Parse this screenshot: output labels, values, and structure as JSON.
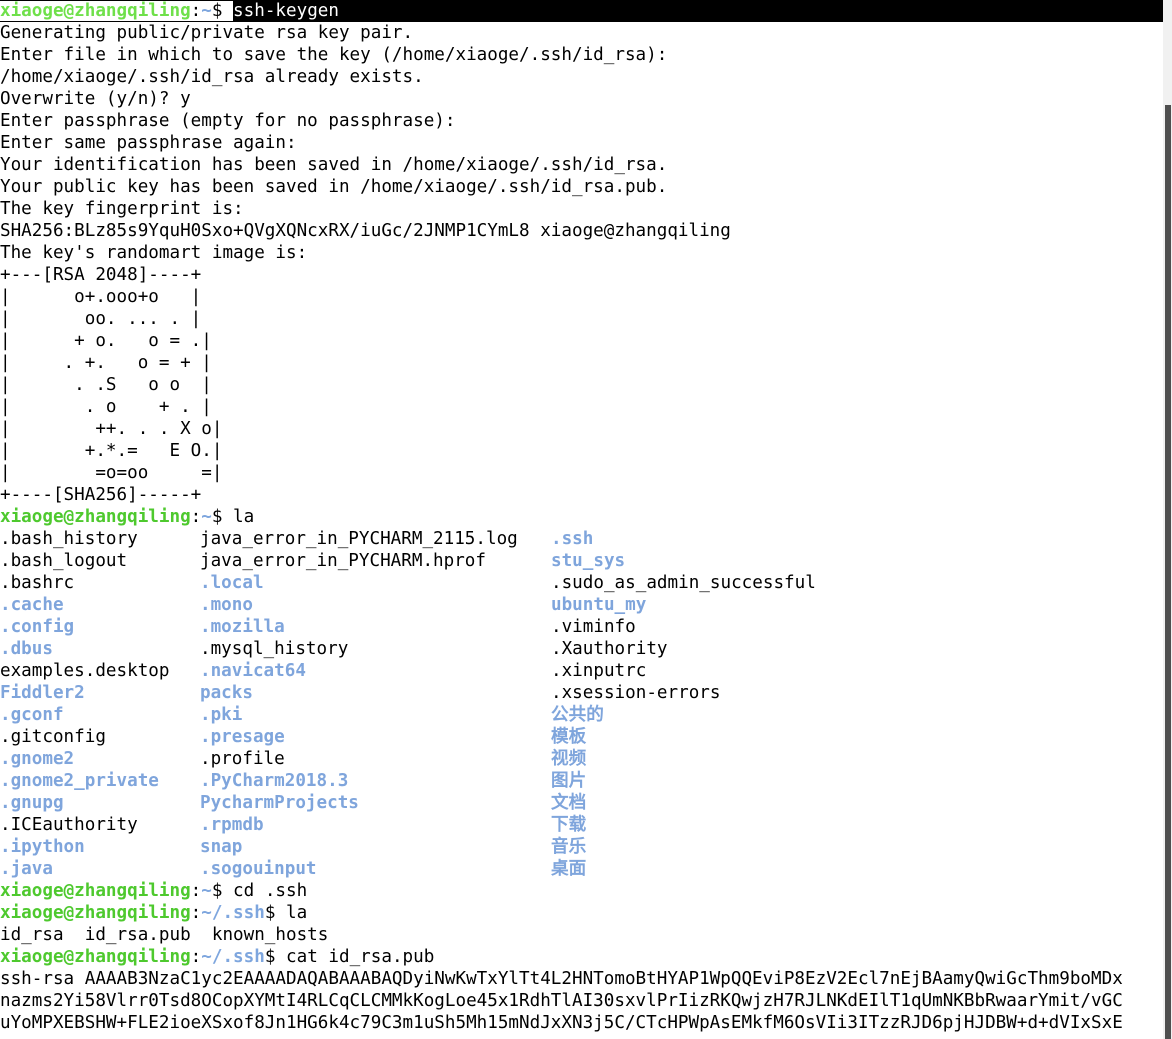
{
  "terminal": {
    "title": "xiaoge@zhangqiling: ~/.ssh",
    "colors": {
      "background": "#ffffff",
      "foreground": "#000000",
      "prompt_user_green": "#4ec92e",
      "path_blue": "#7ea6de",
      "directory_blue": "#7fa5dc",
      "highlight_background": "#000000",
      "highlight_foreground": "#ffffff",
      "scrollbar_thumb": "#4f4f4f",
      "scrollbar_track": "#f1f1f1"
    },
    "prompt": {
      "user_host": "xiaoge@zhangqiling",
      "colon": ":",
      "home_tilde": "~",
      "ssh_path": "/.ssh",
      "dollar": "$"
    },
    "commands": {
      "ssh_keygen": "ssh-keygen",
      "la": "la",
      "cd_ssh": "cd .ssh",
      "cat_id_rsa_pub": "cat id_rsa.pub"
    },
    "keygen_output": [
      "Generating public/private rsa key pair.",
      "Enter file in which to save the key (/home/xiaoge/.ssh/id_rsa):",
      "/home/xiaoge/.ssh/id_rsa already exists.",
      "Overwrite (y/n)? y",
      "Enter passphrase (empty for no passphrase):",
      "Enter same passphrase again:",
      "Your identification has been saved in /home/xiaoge/.ssh/id_rsa.",
      "Your public key has been saved in /home/xiaoge/.ssh/id_rsa.pub.",
      "The key fingerprint is:",
      "SHA256:BLz85s9YquH0Sxo+QVgXQNcxRX/iuGc/2JNMP1CYmL8 xiaoge@zhangqiling",
      "The key's randomart image is:"
    ],
    "randomart": [
      "+---[RSA 2048]----+",
      "|      o+.ooo+o   |",
      "|       oo. ... . |",
      "|      + o.   o = .|",
      "|     . +.   o = + |",
      "|      . .S   o o  |",
      "|       . o    + . |",
      "|        ++. . . X o|",
      "|       +.*.=   E O.|",
      "|        =o=oo     =|",
      "+----[SHA256]-----+"
    ],
    "listing_home": {
      "col1": [
        {
          "name": ".bash_history",
          "type": "file"
        },
        {
          "name": ".bash_logout",
          "type": "file"
        },
        {
          "name": ".bashrc",
          "type": "file"
        },
        {
          "name": ".cache",
          "type": "dir"
        },
        {
          "name": ".config",
          "type": "dir"
        },
        {
          "name": ".dbus",
          "type": "dir"
        },
        {
          "name": "examples.desktop",
          "type": "file"
        },
        {
          "name": "Fiddler2",
          "type": "dir"
        },
        {
          "name": ".gconf",
          "type": "dir"
        },
        {
          "name": ".gitconfig",
          "type": "file"
        },
        {
          "name": ".gnome2",
          "type": "dir"
        },
        {
          "name": ".gnome2_private",
          "type": "dir"
        },
        {
          "name": ".gnupg",
          "type": "dir"
        },
        {
          "name": ".ICEauthority",
          "type": "file"
        },
        {
          "name": ".ipython",
          "type": "dir"
        },
        {
          "name": ".java",
          "type": "dir"
        }
      ],
      "col2": [
        {
          "name": "java_error_in_PYCHARM_2115.log",
          "type": "file"
        },
        {
          "name": "java_error_in_PYCHARM.hprof",
          "type": "file"
        },
        {
          "name": ".local",
          "type": "dir"
        },
        {
          "name": ".mono",
          "type": "dir"
        },
        {
          "name": ".mozilla",
          "type": "dir"
        },
        {
          "name": ".mysql_history",
          "type": "file"
        },
        {
          "name": ".navicat64",
          "type": "dir"
        },
        {
          "name": "packs",
          "type": "dir"
        },
        {
          "name": ".pki",
          "type": "dir"
        },
        {
          "name": ".presage",
          "type": "dir"
        },
        {
          "name": ".profile",
          "type": "file"
        },
        {
          "name": ".PyCharm2018.3",
          "type": "dir"
        },
        {
          "name": "PycharmProjects",
          "type": "dir"
        },
        {
          "name": ".rpmdb",
          "type": "dir"
        },
        {
          "name": "snap",
          "type": "dir"
        },
        {
          "name": ".sogouinput",
          "type": "dir"
        }
      ],
      "col3": [
        {
          "name": ".ssh",
          "type": "dir"
        },
        {
          "name": "stu_sys",
          "type": "dir"
        },
        {
          "name": ".sudo_as_admin_successful",
          "type": "file"
        },
        {
          "name": "ubuntu_my",
          "type": "dir"
        },
        {
          "name": ".viminfo",
          "type": "file"
        },
        {
          "name": ".Xauthority",
          "type": "file"
        },
        {
          "name": ".xinputrc",
          "type": "file"
        },
        {
          "name": ".xsession-errors",
          "type": "file"
        },
        {
          "name": "公共的",
          "type": "dir"
        },
        {
          "name": "模板",
          "type": "dir"
        },
        {
          "name": "视频",
          "type": "dir"
        },
        {
          "name": "图片",
          "type": "dir"
        },
        {
          "name": "文档",
          "type": "dir"
        },
        {
          "name": "下载",
          "type": "dir"
        },
        {
          "name": "音乐",
          "type": "dir"
        },
        {
          "name": "桌面",
          "type": "dir"
        }
      ]
    },
    "listing_ssh": "id_rsa  id_rsa.pub  known_hosts",
    "public_key_lines": [
      "ssh-rsa AAAAB3NzaC1yc2EAAAADAQABAAABAQDyiNwKwTxYlTt4L2HNTomoBtHYAP1WpQQEviP8EzV2Ecl7nEjBAamyQwiGcThm9boMDx",
      "nazms2Yi58Vlrr0Tsd8OCopXYMtI4RLCqCLCMMkKogLoe45x1RdhTlAI30sxvlPrIizRKQwjzH7RJLNKdEIlT1qUmNKBbRwaarYmit/vGC",
      "uYoMPXEBSHW+FLE2ioeXSxof8Jn1HG6k4c79C3m1uSh5Mh15mNdJxXN3j5C/CTcHPWpAsEMkfM6OsVIi3ITzzRJD6pjHJDBW+d+dVIxSxE"
    ]
  }
}
